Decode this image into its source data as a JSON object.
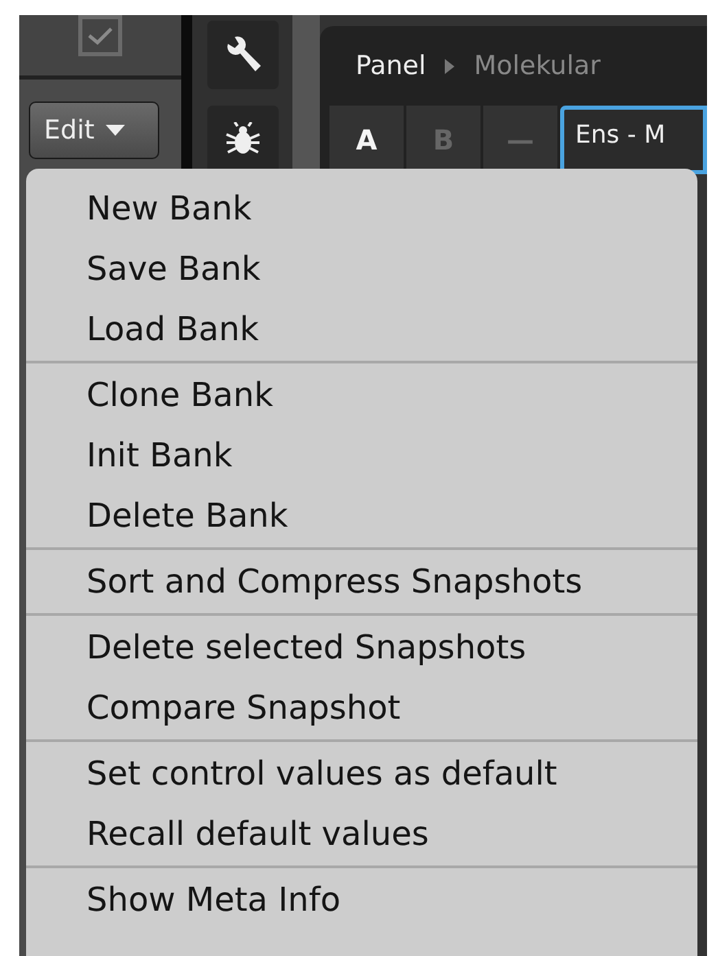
{
  "sidebar": {
    "checkbox": {
      "checked": true
    },
    "edit_button": "Edit"
  },
  "tools": [
    {
      "kind": "wrench"
    },
    {
      "kind": "bug"
    }
  ],
  "breadcrumb": [
    "Panel",
    "Molekular"
  ],
  "snapshot_tabs": [
    {
      "label": "A",
      "selected": true
    },
    {
      "label": "B",
      "selected": false
    },
    {
      "label": "—",
      "selected": false
    }
  ],
  "snapshot_field": {
    "value": "Ens - M"
  },
  "menu": {
    "groups": [
      [
        "New Bank",
        "Save Bank",
        "Load Bank"
      ],
      [
        "Clone Bank",
        "Init Bank",
        "Delete Bank"
      ],
      [
        "Sort and Compress Snapshots"
      ],
      [
        "Delete selected Snapshots",
        "Compare Snapshot"
      ],
      [
        "Set control values as default",
        "Recall default values"
      ],
      [
        "Show Meta Info"
      ]
    ]
  }
}
